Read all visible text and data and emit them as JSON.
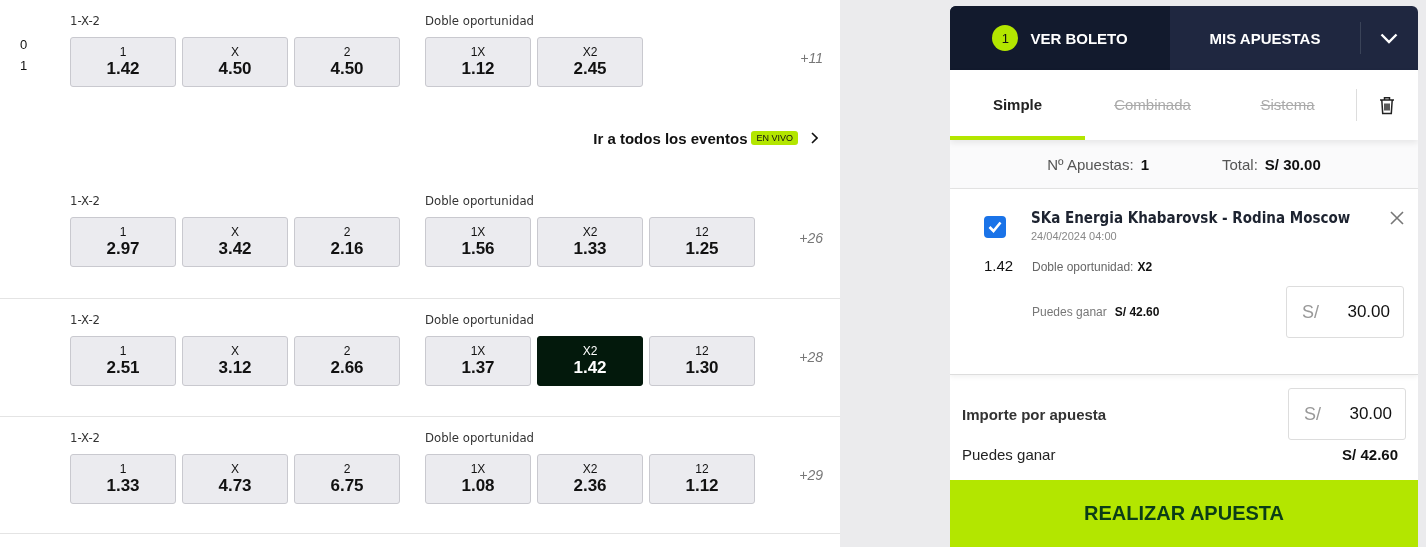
{
  "events": [
    {
      "score": [
        "0",
        "1"
      ],
      "more": "+11",
      "markets": [
        {
          "title": "1-X-2",
          "odds": [
            {
              "label": "1",
              "value": "1.42",
              "selected": false
            },
            {
              "label": "X",
              "value": "4.50",
              "selected": false
            },
            {
              "label": "2",
              "value": "4.50",
              "selected": false
            }
          ]
        },
        {
          "title": "Doble oportunidad",
          "odds": [
            {
              "label": "1X",
              "value": "1.12",
              "selected": false
            },
            {
              "label": "X2",
              "value": "2.45",
              "selected": false
            }
          ]
        }
      ]
    },
    {
      "more": "+26",
      "markets": [
        {
          "title": "1-X-2",
          "odds": [
            {
              "label": "1",
              "value": "2.97",
              "selected": false
            },
            {
              "label": "X",
              "value": "3.42",
              "selected": false
            },
            {
              "label": "2",
              "value": "2.16",
              "selected": false
            }
          ]
        },
        {
          "title": "Doble oportunidad",
          "odds": [
            {
              "label": "1X",
              "value": "1.56",
              "selected": false
            },
            {
              "label": "X2",
              "value": "1.33",
              "selected": false
            },
            {
              "label": "12",
              "value": "1.25",
              "selected": false
            }
          ]
        }
      ]
    },
    {
      "more": "+28",
      "markets": [
        {
          "title": "1-X-2",
          "odds": [
            {
              "label": "1",
              "value": "2.51",
              "selected": false
            },
            {
              "label": "X",
              "value": "3.12",
              "selected": false
            },
            {
              "label": "2",
              "value": "2.66",
              "selected": false
            }
          ]
        },
        {
          "title": "Doble oportunidad",
          "odds": [
            {
              "label": "1X",
              "value": "1.37",
              "selected": false
            },
            {
              "label": "X2",
              "value": "1.42",
              "selected": true
            },
            {
              "label": "12",
              "value": "1.30",
              "selected": false
            }
          ]
        }
      ]
    },
    {
      "more": "+29",
      "markets": [
        {
          "title": "1-X-2",
          "odds": [
            {
              "label": "1",
              "value": "1.33",
              "selected": false
            },
            {
              "label": "X",
              "value": "4.73",
              "selected": false
            },
            {
              "label": "2",
              "value": "6.75",
              "selected": false
            }
          ]
        },
        {
          "title": "Doble oportunidad",
          "odds": [
            {
              "label": "1X",
              "value": "1.08",
              "selected": false
            },
            {
              "label": "X2",
              "value": "2.36",
              "selected": false
            },
            {
              "label": "12",
              "value": "1.12",
              "selected": false
            }
          ]
        }
      ]
    }
  ],
  "live_link": {
    "label": "Ir a todos los eventos",
    "badge": "EN VIVO"
  },
  "betslip": {
    "tabs": [
      {
        "label": "VER BOLETO",
        "badge": "1",
        "selected": true
      },
      {
        "label": "MIS APUESTAS",
        "selected": false
      }
    ],
    "bet_types": [
      {
        "label": "Simple",
        "selected": true,
        "disabled": false
      },
      {
        "label": "Combinada",
        "selected": false,
        "disabled": true
      },
      {
        "label": "Sistema",
        "selected": false,
        "disabled": true
      }
    ],
    "summary": {
      "count_label": "Nº Apuestas:",
      "count": "1",
      "total_label": "Total:",
      "total": "S/ 30.00"
    },
    "bet": {
      "checked": true,
      "match": "SKa Energia Khabarovsk - Rodina Moscow",
      "datetime": "24/04/2024 04:00",
      "odds": "1.42",
      "market": "Doble oportunidad:",
      "selection": "X2",
      "win_label": "Puedes ganar",
      "win": "S/ 42.60",
      "currency": "S/",
      "stake": "30.00"
    },
    "footer": {
      "stake_label": "Importe por apuesta",
      "currency": "S/",
      "stake": "30.00",
      "win_label": "Puedes ganar",
      "win": "S/ 42.60"
    },
    "submit": "REALIZAR APUESTA"
  }
}
